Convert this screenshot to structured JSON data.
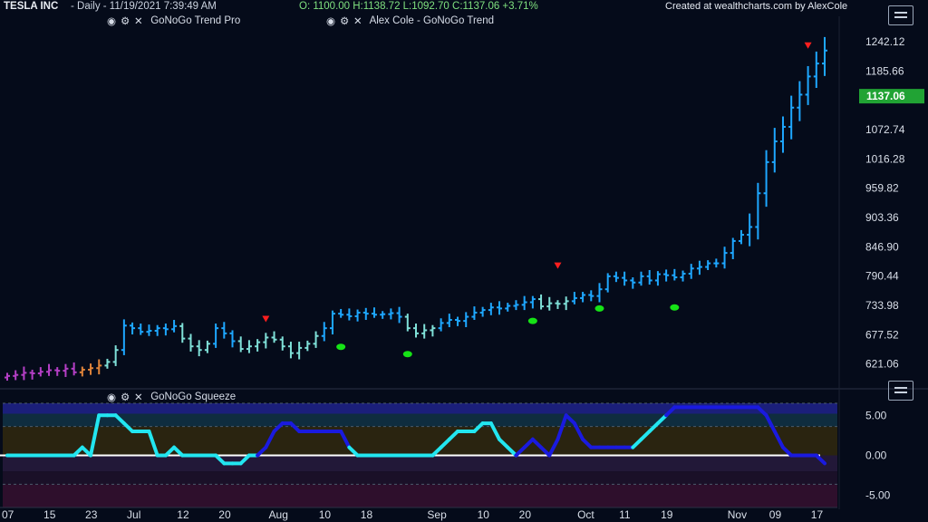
{
  "header": {
    "symbol": "TESLA INC",
    "meta": "- Daily - 11/19/2021 7:39:49 AM",
    "ohlc": "O: 1100.00 H:1138.72 L:1092.70 C:1137.06 +3.71%",
    "credit": "Created at wealthcharts.com by AlexCole",
    "study1": "GoNoGo Trend Pro",
    "study2": "Alex Cole - GoNoGo Trend",
    "squeeze": "GoNoGo Squeeze"
  },
  "colors": {
    "background": "#050b1a",
    "go_strong": "#1ea7ff",
    "go_weak": "#7fe0d8",
    "nogo_strong": "#b53fc6",
    "nogo_weak": "#e0843a",
    "last_price_tag": "#21a334",
    "reentry_dot": "#16e316",
    "reversal_arrow": "#ff1e1e",
    "squeeze_line": "#22e6f0",
    "squeeze_max": "#1a1adf"
  },
  "chart_data": [
    {
      "type": "candlestick",
      "title": "TESLA INC",
      "y_ticks": [
        "1242.12",
        "1185.66",
        "1072.74",
        "1016.28",
        "959.82",
        "903.36",
        "846.90",
        "790.44",
        "733.98",
        "677.52",
        "621.06"
      ],
      "y_range": [
        575,
        1270
      ],
      "last_price": 1137.06,
      "last_price_label": "1137.06",
      "x_labels": [
        "07",
        "15",
        "23",
        "Jul",
        "12",
        "20",
        "Aug",
        "10",
        "18",
        "Sep",
        "10",
        "20",
        "Oct",
        "11",
        "19",
        "Nov",
        "09",
        "17"
      ],
      "x_label_index": [
        0,
        5,
        10,
        15,
        21,
        26,
        32,
        38,
        43,
        51,
        57,
        62,
        69,
        74,
        79,
        87,
        92,
        97
      ],
      "bars_count": 99,
      "close": [
        598,
        600,
        604,
        603,
        606,
        609,
        608,
        612,
        605,
        610,
        613,
        618,
        625,
        648,
        695,
        690,
        683,
        685,
        690,
        688,
        694,
        670,
        655,
        648,
        660,
        690,
        680,
        665,
        650,
        655,
        663,
        672,
        668,
        655,
        642,
        652,
        660,
        675,
        690,
        718,
        716,
        713,
        720,
        718,
        716,
        717,
        719,
        712,
        690,
        680,
        686,
        690,
        700,
        706,
        704,
        712,
        720,
        725,
        730,
        728,
        733,
        735,
        740,
        746,
        732,
        738,
        737,
        742,
        748,
        754,
        752,
        765,
        790,
        787,
        782,
        778,
        790,
        782,
        794,
        792,
        788,
        795,
        805,
        808,
        815,
        815,
        835,
        858,
        870,
        885,
        950,
        1010,
        1050,
        1078,
        1115,
        1140,
        1175,
        1200,
        1225
      ],
      "ohlc_columns": [
        "open",
        "high",
        "low",
        "close"
      ],
      "trend_color": [
        "nogo_strong",
        "nogo_strong",
        "nogo_strong",
        "nogo_strong",
        "nogo_strong",
        "nogo_strong",
        "nogo_strong",
        "nogo_strong",
        "nogo_strong",
        "nogo_weak",
        "nogo_weak",
        "nogo_weak",
        "go_weak",
        "go_weak",
        "go_strong",
        "go_strong",
        "go_strong",
        "go_strong",
        "go_strong",
        "go_strong",
        "go_strong",
        "go_weak",
        "go_weak",
        "go_weak",
        "go_weak",
        "go_strong",
        "go_strong",
        "go_strong",
        "go_weak",
        "go_weak",
        "go_weak",
        "go_weak",
        "go_weak",
        "go_weak",
        "go_weak",
        "go_weak",
        "go_weak",
        "go_weak",
        "go_strong",
        "go_strong",
        "go_strong",
        "go_strong",
        "go_strong",
        "go_strong",
        "go_strong",
        "go_strong",
        "go_strong",
        "go_strong",
        "go_weak",
        "go_weak",
        "go_weak",
        "go_weak",
        "go_strong",
        "go_strong",
        "go_strong",
        "go_strong",
        "go_strong",
        "go_strong",
        "go_strong",
        "go_strong",
        "go_strong",
        "go_strong",
        "go_strong",
        "go_strong",
        "go_weak",
        "go_weak",
        "go_weak",
        "go_weak",
        "go_strong",
        "go_strong",
        "go_strong",
        "go_strong",
        "go_strong",
        "go_strong",
        "go_strong",
        "go_strong",
        "go_strong",
        "go_strong",
        "go_strong",
        "go_strong",
        "go_strong",
        "go_strong",
        "go_strong",
        "go_strong",
        "go_strong",
        "go_strong",
        "go_strong",
        "go_strong",
        "go_strong",
        "go_strong",
        "go_strong",
        "go_strong",
        "go_strong",
        "go_strong",
        "go_strong",
        "go_strong",
        "go_strong",
        "go_strong",
        "go_strong"
      ],
      "reversal_arrows": [
        {
          "bar": 31,
          "price": 705
        },
        {
          "bar": 66,
          "price": 808
        },
        {
          "bar": 96,
          "price": 1232
        }
      ],
      "reentry_dots": [
        {
          "bar": 40,
          "price": 654
        },
        {
          "bar": 48,
          "price": 640
        },
        {
          "bar": 63,
          "price": 704
        },
        {
          "bar": 71,
          "price": 728
        },
        {
          "bar": 80,
          "price": 730
        }
      ]
    },
    {
      "type": "line",
      "title": "GoNoGo Squeeze",
      "y_ticks": [
        "5.00",
        "0.00",
        "-5.00"
      ],
      "y_range": [
        -6.5,
        6.5
      ],
      "values": [
        0,
        0,
        0,
        0,
        0,
        0,
        0,
        0,
        0,
        1,
        0,
        5,
        5,
        5,
        4,
        3,
        3,
        3,
        0,
        0,
        1,
        0,
        0,
        0,
        0,
        0,
        -1,
        -1,
        -1,
        0,
        0,
        1,
        3,
        4,
        4,
        3,
        3,
        3,
        3,
        3,
        3,
        1,
        0,
        0,
        0,
        0,
        0,
        0,
        0,
        0,
        0,
        0,
        1,
        2,
        3,
        3,
        3,
        4,
        4,
        2,
        1,
        0,
        1,
        2,
        1,
        0,
        2,
        5,
        4,
        2,
        1,
        1,
        1,
        1,
        1,
        1,
        2,
        3,
        4,
        5,
        6,
        6,
        6,
        6,
        6,
        6,
        6,
        6,
        6,
        6,
        6,
        5,
        3,
        1,
        0,
        0,
        0,
        0,
        -1
      ],
      "max_squeeze_bars": [
        31,
        32,
        33,
        34,
        35,
        36,
        37,
        38,
        39,
        40,
        41,
        62,
        63,
        64,
        65,
        66,
        67,
        68,
        69,
        70,
        71,
        72,
        73,
        74,
        75,
        80,
        81,
        82,
        83,
        84,
        85,
        86,
        87,
        88,
        89,
        90,
        91,
        92,
        93,
        94,
        95,
        96,
        97,
        98
      ]
    }
  ]
}
